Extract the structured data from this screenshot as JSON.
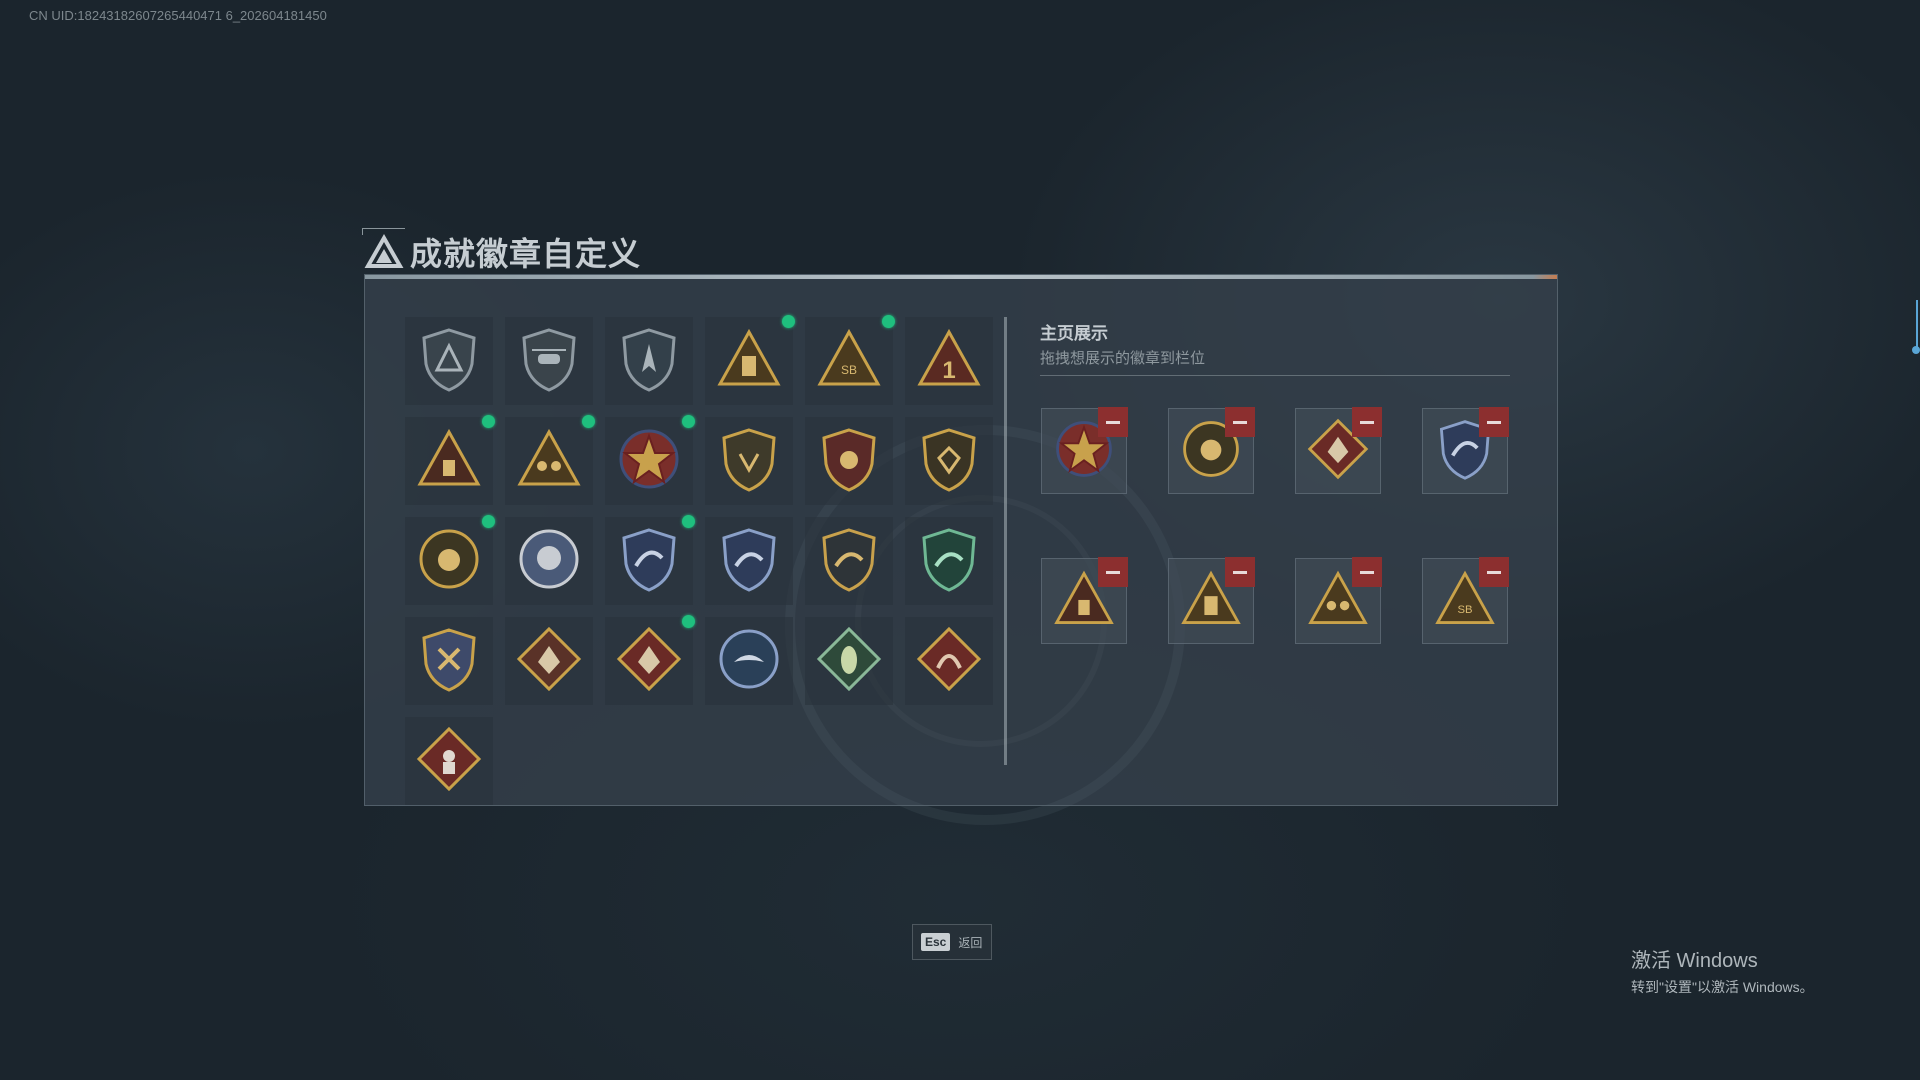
{
  "uid_text": "CN UID:18243182607265440471 6_202604181450",
  "title": "成就徽章自定义",
  "right": {
    "title": "主页展示",
    "subtitle": "拖拽想展示的徽章到栏位"
  },
  "footer": {
    "esc_key": "Esc",
    "esc_label": "返回"
  },
  "windows": {
    "title": "激活 Windows",
    "subtitle": "转到\"设置\"以激活 Windows。"
  },
  "colors": {
    "new_dot": "#1fbf7e",
    "remove": "#8c2f2f",
    "gold": "#c9a24a",
    "steel": "#8f9aa2"
  },
  "badges": [
    {
      "icon": "triangle-shield-badge",
      "new": false
    },
    {
      "icon": "helicopter-badge",
      "new": false
    },
    {
      "icon": "spear-shield-badge",
      "new": false
    },
    {
      "icon": "gold-building-badge",
      "new": true
    },
    {
      "icon": "gold-sb-badge",
      "new": true
    },
    {
      "icon": "gold-number-one-badge",
      "new": false
    },
    {
      "icon": "gold-pyramid-badge",
      "new": true
    },
    {
      "icon": "gold-soldiers-badge",
      "new": true
    },
    {
      "icon": "gold-star-emblem-badge",
      "new": true
    },
    {
      "icon": "winged-shield-badge",
      "new": false
    },
    {
      "icon": "starred-crest-badge",
      "new": false
    },
    {
      "icon": "gem-shield-badge",
      "new": false
    },
    {
      "icon": "gold-helmet-badge",
      "new": true
    },
    {
      "icon": "skull-crest-badge",
      "new": false
    },
    {
      "icon": "blue-shark-crest-badge",
      "new": true
    },
    {
      "icon": "blue-shark-shield-badge",
      "new": false
    },
    {
      "icon": "dark-shark-shield-badge",
      "new": false
    },
    {
      "icon": "green-shark-shield-badge",
      "new": false
    },
    {
      "icon": "gold-cross-crest-badge",
      "new": false
    },
    {
      "icon": "wolf-diamond-badge",
      "new": false
    },
    {
      "icon": "red-wolf-diamond-badge",
      "new": true
    },
    {
      "icon": "blue-eagle-badge",
      "new": false
    },
    {
      "icon": "green-hornet-badge",
      "new": false
    },
    {
      "icon": "red-dragon-badge",
      "new": false
    },
    {
      "icon": "red-soldier-badge",
      "new": false
    }
  ],
  "showcase": [
    {
      "icon": "gold-star-emblem-badge"
    },
    {
      "icon": "gold-helmet-badge"
    },
    {
      "icon": "red-wolf-diamond-badge"
    },
    {
      "icon": "blue-shark-crest-badge"
    },
    {
      "icon": "gold-pyramid-badge"
    },
    {
      "icon": "gold-building-badge"
    },
    {
      "icon": "gold-soldiers-badge"
    },
    {
      "icon": "gold-sb-badge"
    }
  ]
}
